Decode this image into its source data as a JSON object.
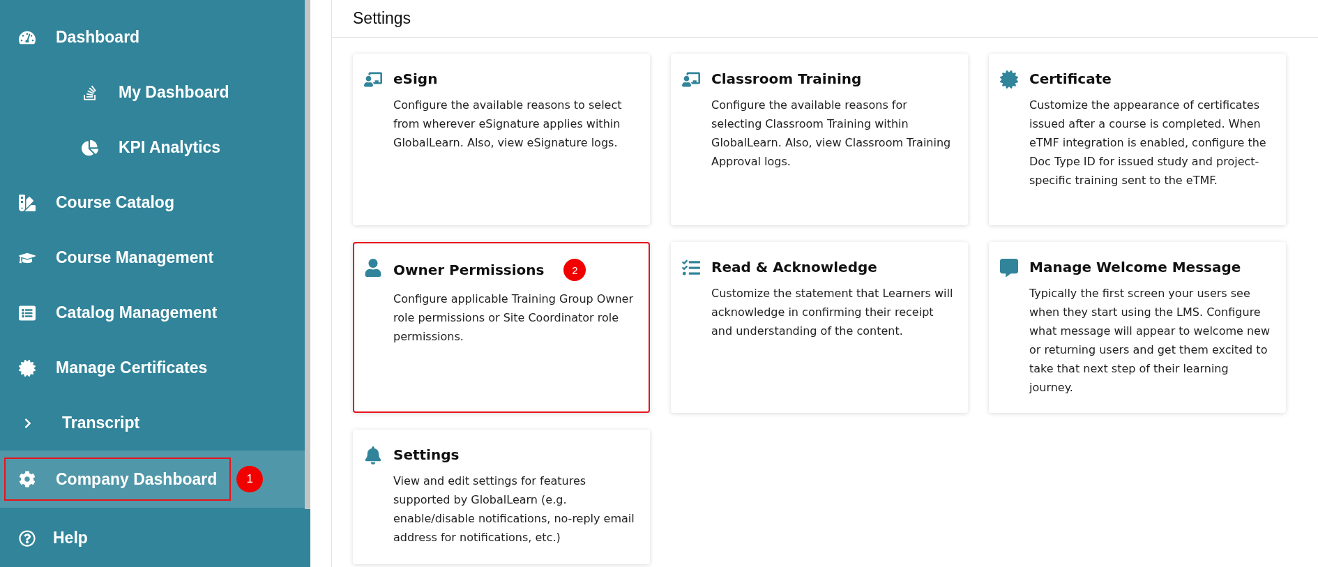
{
  "sidebar": {
    "items": [
      {
        "kind": "item",
        "label": "Dashboard",
        "selected": false,
        "highlighted": false
      },
      {
        "kind": "subitem",
        "label": "My Dashboard",
        "selected": false,
        "highlighted": false
      },
      {
        "kind": "subitem",
        "label": "KPI Analytics",
        "selected": false,
        "highlighted": false
      },
      {
        "kind": "item",
        "label": "Course Catalog",
        "selected": false,
        "highlighted": false
      },
      {
        "kind": "item",
        "label": "Course Management",
        "selected": false,
        "highlighted": false
      },
      {
        "kind": "item",
        "label": "Catalog Management",
        "selected": false,
        "highlighted": false
      },
      {
        "kind": "item",
        "label": "Manage Certificates",
        "selected": false,
        "highlighted": false
      },
      {
        "kind": "group",
        "label": "Transcript",
        "expanded": false,
        "selected": false,
        "highlighted": false
      },
      {
        "kind": "item",
        "label": "Company Dashboard",
        "selected": true,
        "highlighted": true,
        "callout": "1"
      }
    ],
    "help": {
      "label": "Help"
    }
  },
  "main": {
    "title": "Settings",
    "cards": [
      {
        "title": "eSign",
        "description": "Configure the available reasons to select from wherever eSignature applies within GlobalLearn. Also, view eSignature logs.",
        "highlighted": false
      },
      {
        "title": "Classroom Training",
        "description": "Configure the available reasons for selecting Classroom Training within GlobalLearn. Also, view Classroom Training Approval logs.",
        "highlighted": false
      },
      {
        "title": "Certificate",
        "description": "Customize the appearance of certificates issued after a course is completed. When eTMF integration is enabled, configure the Doc Type ID for issued study and project-specific training sent to the eTMF.",
        "highlighted": false
      },
      {
        "title": "Owner Permissions",
        "description": "Configure applicable Training Group Owner role permissions or Site Coordinator role permissions.",
        "highlighted": true,
        "callout": "2"
      },
      {
        "title": "Read & Acknowledge",
        "description": "Customize the statement that Learners will acknowledge in confirming their receipt and understanding of the content.",
        "highlighted": false
      },
      {
        "title": "Manage Welcome Message",
        "description": "Typically the first screen your users see when they start using the LMS. Configure what message will appear to welcome new or returning users and get them excited to take that next step of their learning journey.",
        "highlighted": false
      },
      {
        "title": "Settings",
        "description": "View and edit settings for features supported by GlobalLearn (e.g. enable/disable notifications, no-reply email address for notifications, etc.)",
        "highlighted": false
      }
    ]
  }
}
